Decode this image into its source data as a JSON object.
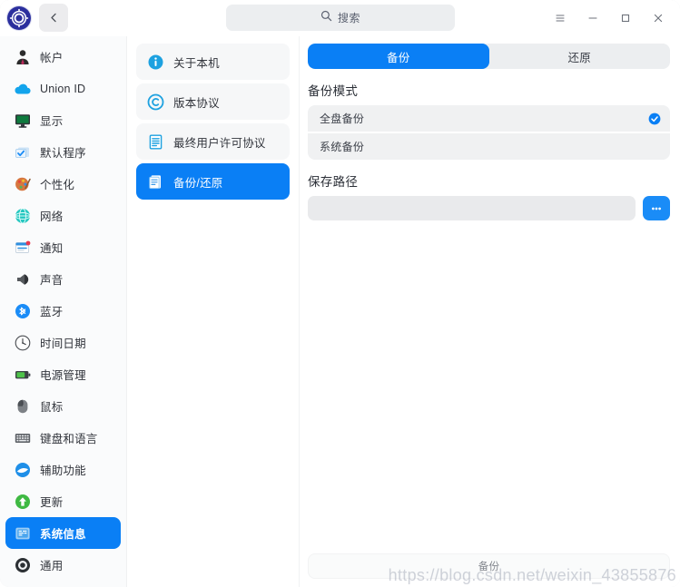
{
  "window": {
    "accent_color": "#0a7ff5",
    "sidebar_bg": "#fafbfc",
    "row_bg": "#f0f1f2"
  },
  "titlebar": {
    "app_logo_name": "deepin-logo-icon",
    "back_label": "‹",
    "search": {
      "placeholder": "搜索",
      "value": "",
      "icon": "search-icon"
    },
    "menu_label": "≡",
    "minimize_label": "─",
    "maximize_label": "□",
    "close_label": "✕"
  },
  "sidebar": {
    "items": [
      {
        "label": "帐户",
        "icon": "account-icon",
        "active": false
      },
      {
        "label": "Union ID",
        "icon": "cloud-icon",
        "active": false
      },
      {
        "label": "显示",
        "icon": "display-icon",
        "active": false
      },
      {
        "label": "默认程序",
        "icon": "default-apps-icon",
        "active": false
      },
      {
        "label": "个性化",
        "icon": "personalization-icon",
        "active": false
      },
      {
        "label": "网络",
        "icon": "network-icon",
        "active": false
      },
      {
        "label": "通知",
        "icon": "notification-icon",
        "active": false
      },
      {
        "label": "声音",
        "icon": "sound-icon",
        "active": false
      },
      {
        "label": "蓝牙",
        "icon": "bluetooth-icon",
        "active": false
      },
      {
        "label": "时间日期",
        "icon": "clock-icon",
        "active": false
      },
      {
        "label": "电源管理",
        "icon": "battery-icon",
        "active": false
      },
      {
        "label": "鼠标",
        "icon": "mouse-icon",
        "active": false
      },
      {
        "label": "键盘和语言",
        "icon": "keyboard-icon",
        "active": false
      },
      {
        "label": "辅助功能",
        "icon": "accessibility-icon",
        "active": false
      },
      {
        "label": "更新",
        "icon": "update-icon",
        "active": false
      },
      {
        "label": "系统信息",
        "icon": "system-info-icon",
        "active": true
      },
      {
        "label": "通用",
        "icon": "general-icon",
        "active": false
      }
    ]
  },
  "midnav": {
    "items": [
      {
        "label": "关于本机",
        "icon": "info-icon",
        "active": false
      },
      {
        "label": "版本协议",
        "icon": "copyright-icon",
        "active": false
      },
      {
        "label": "最终用户许可协议",
        "icon": "document-icon",
        "active": false
      },
      {
        "label": "备份/还原",
        "icon": "backup-icon",
        "active": true
      }
    ]
  },
  "main": {
    "tabs": [
      {
        "label": "备份",
        "active": true
      },
      {
        "label": "还原",
        "active": false
      }
    ],
    "backup_mode": {
      "title": "备份模式",
      "options": [
        {
          "label": "全盘备份",
          "selected": true
        },
        {
          "label": "系统备份",
          "selected": false
        }
      ]
    },
    "save_path": {
      "title": "保存路径",
      "value": "",
      "placeholder": "",
      "browse_label": "…"
    },
    "action_button": {
      "label": "备份"
    }
  },
  "watermark": {
    "text": "https://blog.csdn.net/weixin_43855876"
  }
}
